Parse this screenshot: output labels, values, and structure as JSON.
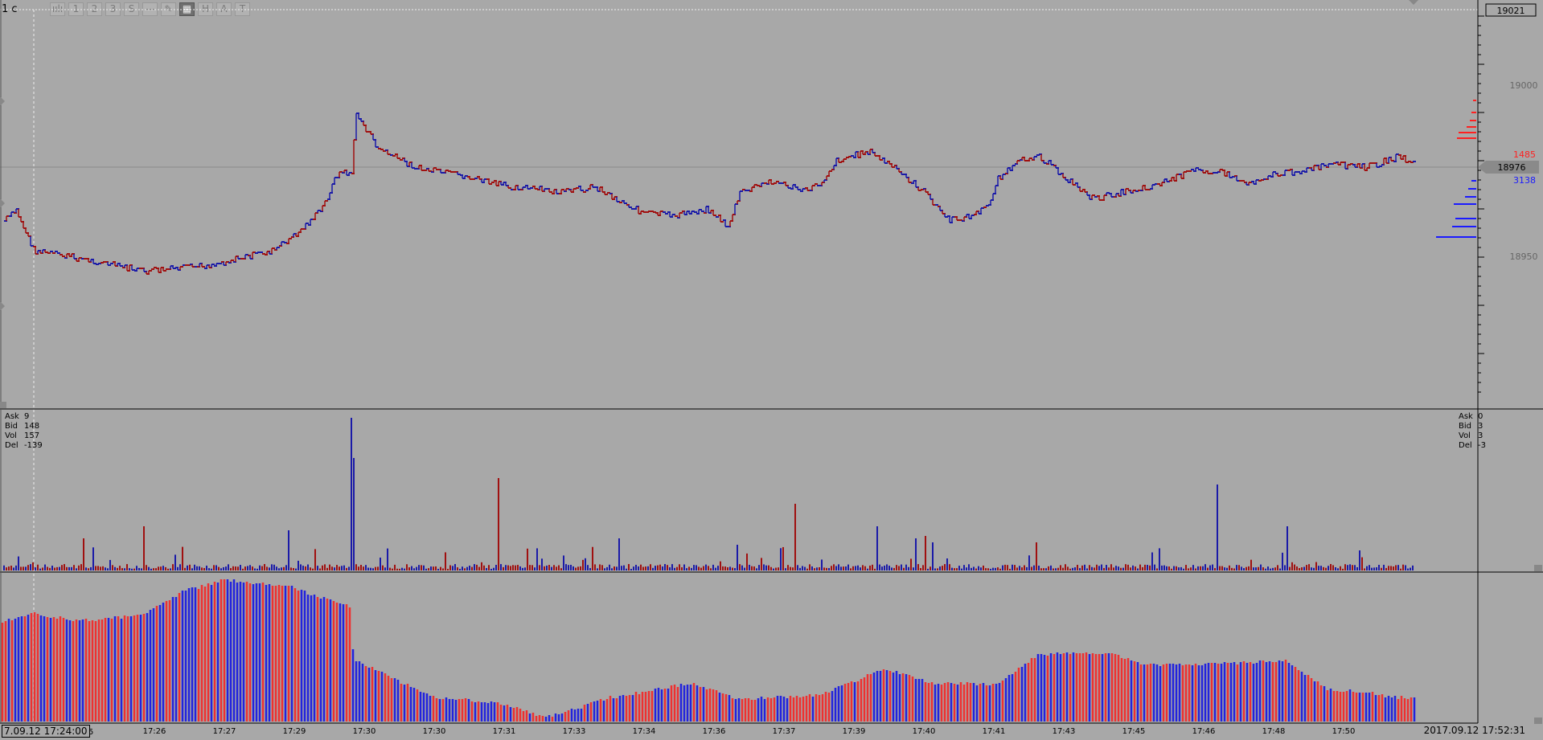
{
  "toolbar": {
    "title": "1 c",
    "buttons": [
      {
        "name": "chart-button",
        "label": "ıılı"
      },
      {
        "name": "one-button",
        "label": "1"
      },
      {
        "name": "two-button",
        "label": "2"
      },
      {
        "name": "three-button",
        "label": "3"
      },
      {
        "name": "s-button",
        "label": "S"
      },
      {
        "name": "line-tool-button",
        "label": "—"
      },
      {
        "name": "pencil-tool-button",
        "label": "✎"
      },
      {
        "name": "grid-button",
        "label": "▦"
      },
      {
        "name": "h-button",
        "label": "H"
      },
      {
        "name": "a-button",
        "label": "A"
      },
      {
        "name": "t-button",
        "label": "T"
      }
    ]
  },
  "price_axis": {
    "top_label": "19021",
    "ticks": [
      "19000",
      "18950"
    ],
    "current_price": "18976",
    "ask_total": "1485",
    "bid_total": "3138"
  },
  "cursor_info": {
    "ask_label": "Ask",
    "ask": "9",
    "bid_label": "Bid",
    "bid": "148",
    "vol_label": "Vol",
    "vol": "157",
    "del_label": "Del",
    "del": "-139"
  },
  "last_info": {
    "ask_label": "Ask",
    "ask": "0",
    "bid_label": "Bid",
    "bid": "3",
    "vol_label": "Vol",
    "vol": "3",
    "del_label": "Del",
    "del": "-3"
  },
  "time_axis": {
    "labels": [
      "25",
      "17:26",
      "17:27",
      "17:29",
      "17:30",
      "17:30",
      "17:31",
      "17:33",
      "17:34",
      "17:36",
      "17:37",
      "17:39",
      "17:40",
      "17:41",
      "17:43",
      "17:45",
      "17:46",
      "17:48",
      "17:50"
    ],
    "cursor_time": "7.09.12 17:24:00",
    "current_time": "2017.09.12 17:52:31"
  },
  "colors": {
    "background": "#a8a8a8",
    "buy": "#1a1aa8",
    "sell": "#a01010",
    "ask_text": "#ff2020",
    "bid_text": "#1a1aff"
  }
}
